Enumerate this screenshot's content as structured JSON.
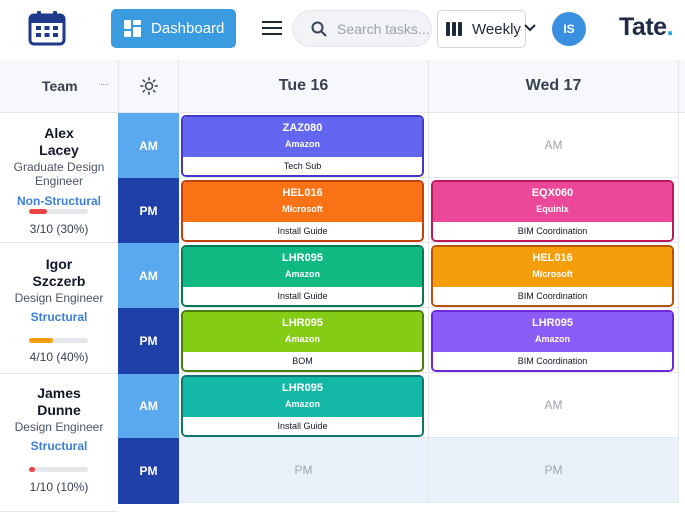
{
  "header": {
    "dashboard_label": "Dashboard",
    "search_placeholder": "Search tasks...",
    "view_label": "Weekly",
    "avatar_initials": "IS",
    "logo_text": "Tate",
    "logo_dot": ".",
    "icons": {
      "calendar": "calendar-icon",
      "dashboard": "dashboard-grid-icon",
      "menu": "hamburger-menu-icon",
      "search": "search-icon",
      "view": "columns-icon",
      "chevron": "chevron-down-icon"
    },
    "colors": {
      "primary": "#3b9be0",
      "logo": "#1e2a46",
      "logo_dot": "#1ea5e5"
    }
  },
  "grid": {
    "team_header": "Team",
    "theme_icon": "sun-icon",
    "days": [
      "Tue 16",
      "Wed 17"
    ],
    "slot_am": "AM",
    "slot_pm": "PM",
    "members": [
      {
        "name_line1": "Alex",
        "name_line2": "Lacey",
        "role": "Graduate Design Engineer",
        "discipline": "Non-Structural",
        "utilization": "3/10 (30%)",
        "fill": 0.3,
        "fill_color": "#ef4444"
      },
      {
        "name_line1": "Igor",
        "name_line2": "Szczerb",
        "role": "Design Engineer",
        "discipline": "Structural",
        "utilization": "4/10 (40%)",
        "fill": 0.4,
        "fill_color": "#f59e0b"
      },
      {
        "name_line1": "James",
        "name_line2": "Dunne",
        "role": "Design Engineer",
        "discipline": "Structural",
        "utilization": "1/10 (10%)",
        "fill": 0.1,
        "fill_color": "#ef4444"
      }
    ],
    "cells": {
      "m0_am_d0": {
        "code": "ZAZ080",
        "client": "Amazon",
        "task": "Tech Sub",
        "color": "#6366f1",
        "border": "#4338ca"
      },
      "m0_am_d1": {
        "empty": "AM"
      },
      "m0_pm_d0": {
        "code": "HEL016",
        "client": "Microsoft",
        "task": "Install Guide",
        "color": "#f97316",
        "border": "#c2410c"
      },
      "m0_pm_d1": {
        "code": "EQX060",
        "client": "Equinix",
        "task": "BIM Coordination",
        "color": "#ec4899",
        "border": "#be185d"
      },
      "m1_am_d0": {
        "code": "LHR095",
        "client": "Amazon",
        "task": "Install Guide",
        "color": "#10b981",
        "border": "#047857"
      },
      "m1_am_d1": {
        "code": "HEL016",
        "client": "Microsoft",
        "task": "BIM Coordination",
        "color": "#f59e0b",
        "border": "#b45309"
      },
      "m1_pm_d0": {
        "code": "LHR095",
        "client": "Amazon",
        "task": "BOM",
        "color": "#84cc16",
        "border": "#4d7c0f"
      },
      "m1_pm_d1": {
        "code": "LHR095",
        "client": "Amazon",
        "task": "BIM Coordination",
        "color": "#8b5cf6",
        "border": "#6d28d9"
      },
      "m2_am_d0": {
        "code": "LHR095",
        "client": "Amazon",
        "task": "Install Guide",
        "color": "#14b8a6",
        "border": "#0f766e"
      },
      "m2_am_d1": {
        "empty": "AM"
      },
      "m2_pm_d0": {
        "empty": "PM"
      },
      "m2_pm_d1": {
        "empty": "PM"
      }
    }
  }
}
